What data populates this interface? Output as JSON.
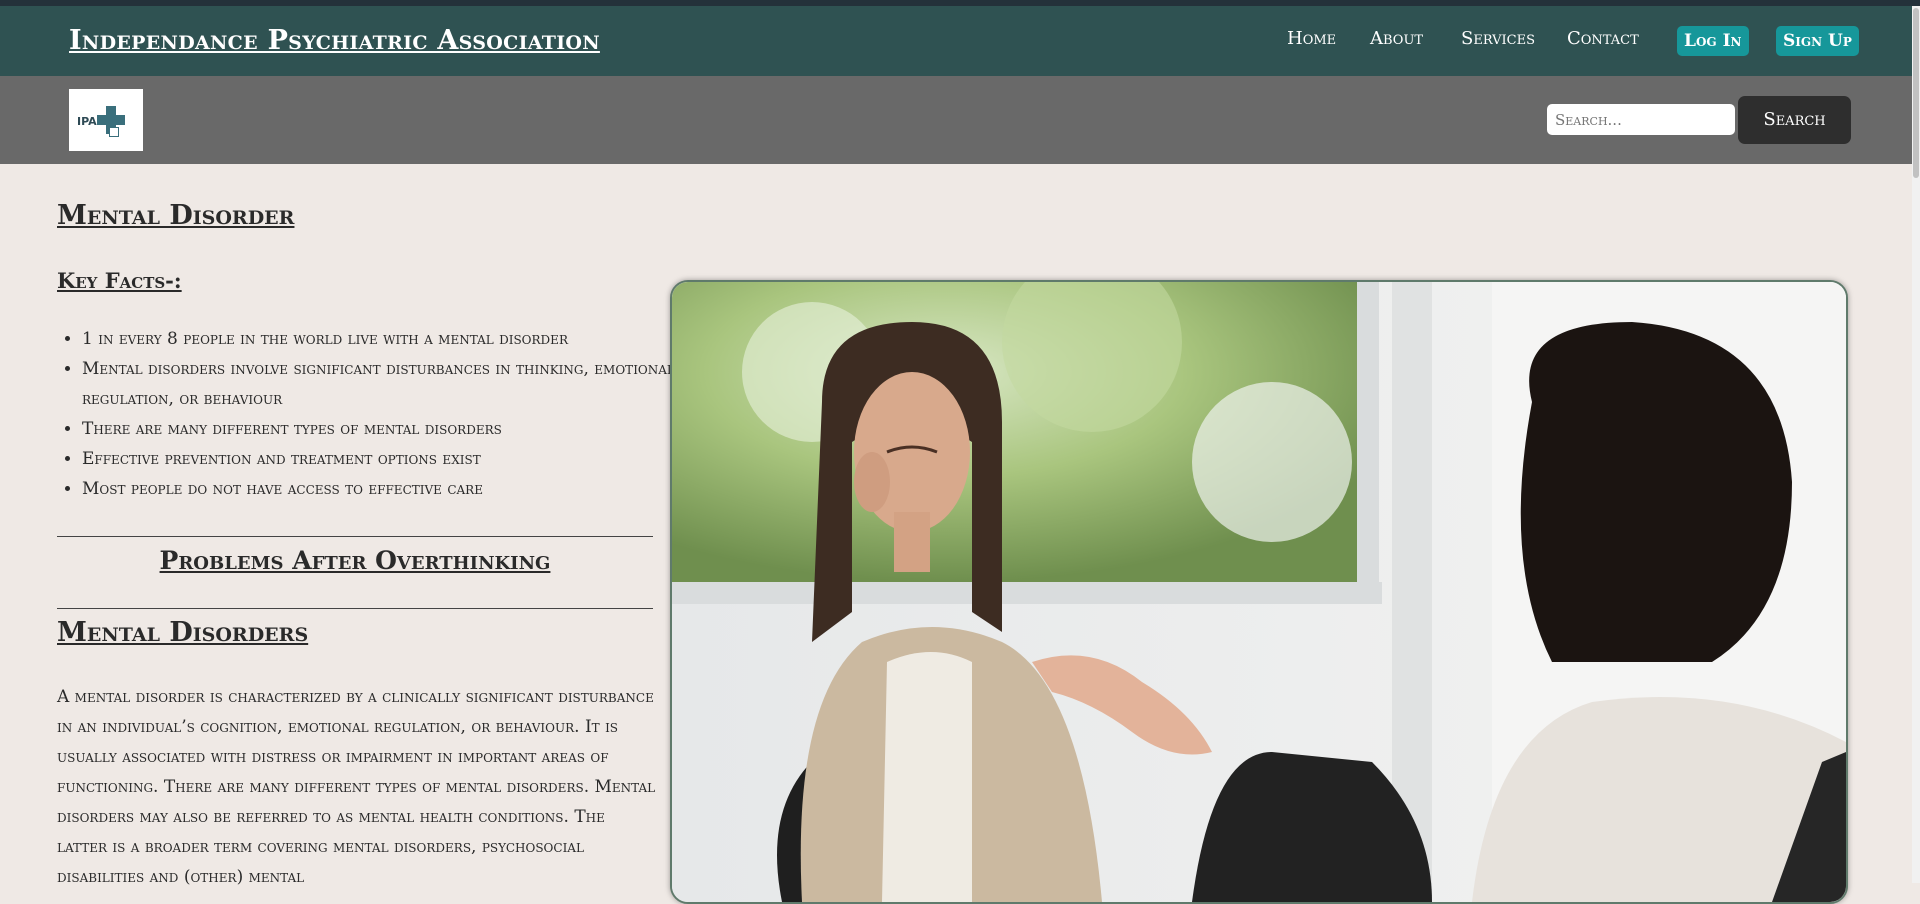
{
  "navbar": {
    "brand": "Independance Psychiatric Association",
    "links": [
      "Home",
      "About",
      "Services",
      "Contact"
    ],
    "login": "Log In",
    "signup": "Sign Up"
  },
  "subbar": {
    "logo_text": "IPA",
    "search_placeholder": "Search...",
    "search_button": "Search"
  },
  "main": {
    "title": "Mental Disorder",
    "key_facts_heading": "Key Facts-:",
    "facts": [
      "1 in every 8 people in the world live with a mental disorder",
      "Mental disorders involve significant disturbances in thinking, emotional regulation, or behaviour",
      "There are many different types of mental disorders",
      "Effective prevention and treatment options exist",
      "Most people do not have access to effective care"
    ],
    "problems_heading": "Problems After Overthinking",
    "section_heading": "Mental Disorders",
    "paragraph": "A mental disorder is characterized by a clinically significant disturbance in an individual’s cognition, emotional regulation, or behaviour. It is usually associated with distress or impairment in important areas of functioning. There are many different types of mental disorders. Mental disorders may also be referred to as mental health conditions. The latter is a broader term covering mental disorders, psychosocial disabilities and (other) mental"
  }
}
